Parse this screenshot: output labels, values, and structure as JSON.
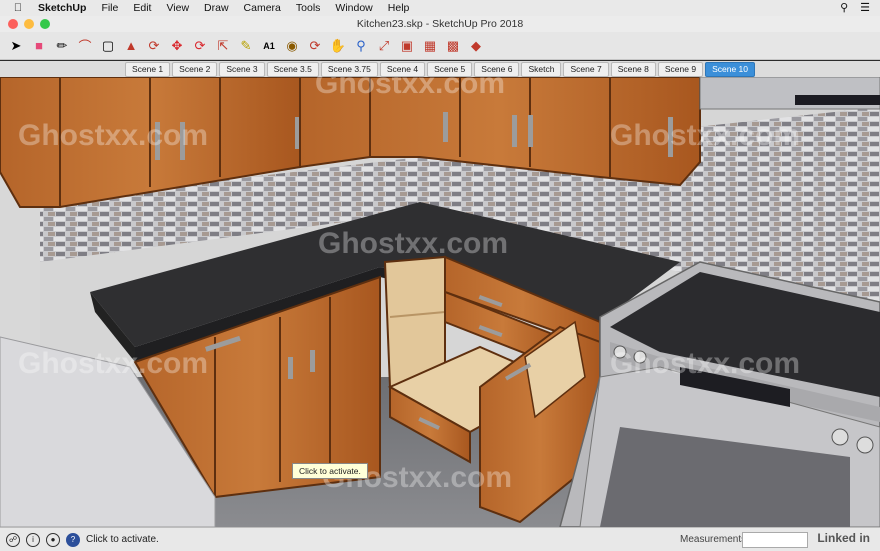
{
  "menubar": {
    "app_name": "SketchUp",
    "items": [
      "File",
      "Edit",
      "View",
      "Draw",
      "Camera",
      "Tools",
      "Window",
      "Help"
    ]
  },
  "window": {
    "title": "Kitchen23.skp - SketchUp Pro 2018"
  },
  "toolbar": {
    "tools": [
      "select-icon",
      "eraser-icon",
      "pencil-icon",
      "arc-icon",
      "rectangle-icon",
      "push-pull-icon",
      "offset-icon",
      "move-icon",
      "rotate-icon",
      "scale-icon",
      "tape-measure-icon",
      "text-icon",
      "paint-bucket-icon",
      "orbit-icon",
      "pan-icon",
      "zoom-icon",
      "zoom-extents-icon",
      "warehouse-icon",
      "extension-icon",
      "components-icon",
      "ruby-icon"
    ]
  },
  "scenes": {
    "tabs": [
      "Scene 1",
      "Scene 2",
      "Scene 3",
      "Scene 3.5",
      "Scene 3.75",
      "Scene 4",
      "Scene 5",
      "Scene 6",
      "Sketch",
      "Scene 7",
      "Scene 8",
      "Scene 9",
      "Scene 10"
    ],
    "active": "Scene 10"
  },
  "viewport": {
    "tooltip": "Click to activate.",
    "watermark": "Ghostxx.com"
  },
  "statusbar": {
    "message": "Click to activate.",
    "measurements_label": "Measurements",
    "brand": "Linked in"
  },
  "colors": {
    "accent": "#3b8fd9",
    "cabinet": "#b8672d",
    "countertop": "#2c2c2c"
  }
}
